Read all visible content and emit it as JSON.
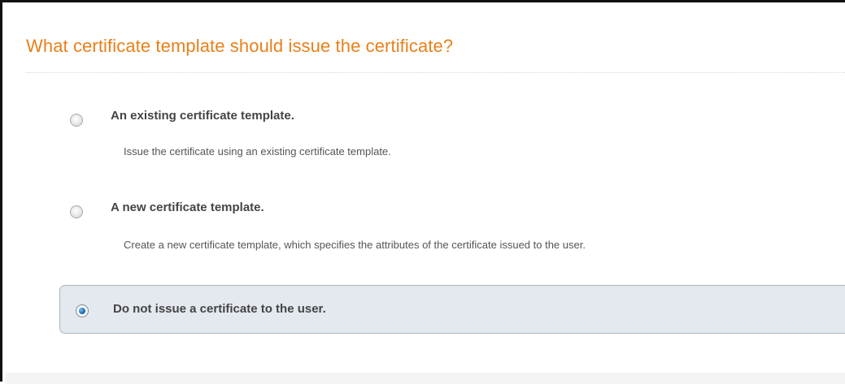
{
  "page": {
    "heading": "What certificate template should issue the certificate?"
  },
  "options": [
    {
      "title": "An existing certificate template.",
      "description": "Issue the certificate using an existing certificate template.",
      "selected": false
    },
    {
      "title": "A new certificate template.",
      "description": "Create a new certificate template, which specifies the attributes of the certificate issued to the user.",
      "selected": false
    },
    {
      "title": "Do not issue a certificate to the user.",
      "selected": true
    }
  ],
  "colors": {
    "heading": "#e8801a",
    "selected_background": "#e3e9ef",
    "selected_border": "#a9b5c1",
    "radio_dot": "#1f6fb6"
  }
}
